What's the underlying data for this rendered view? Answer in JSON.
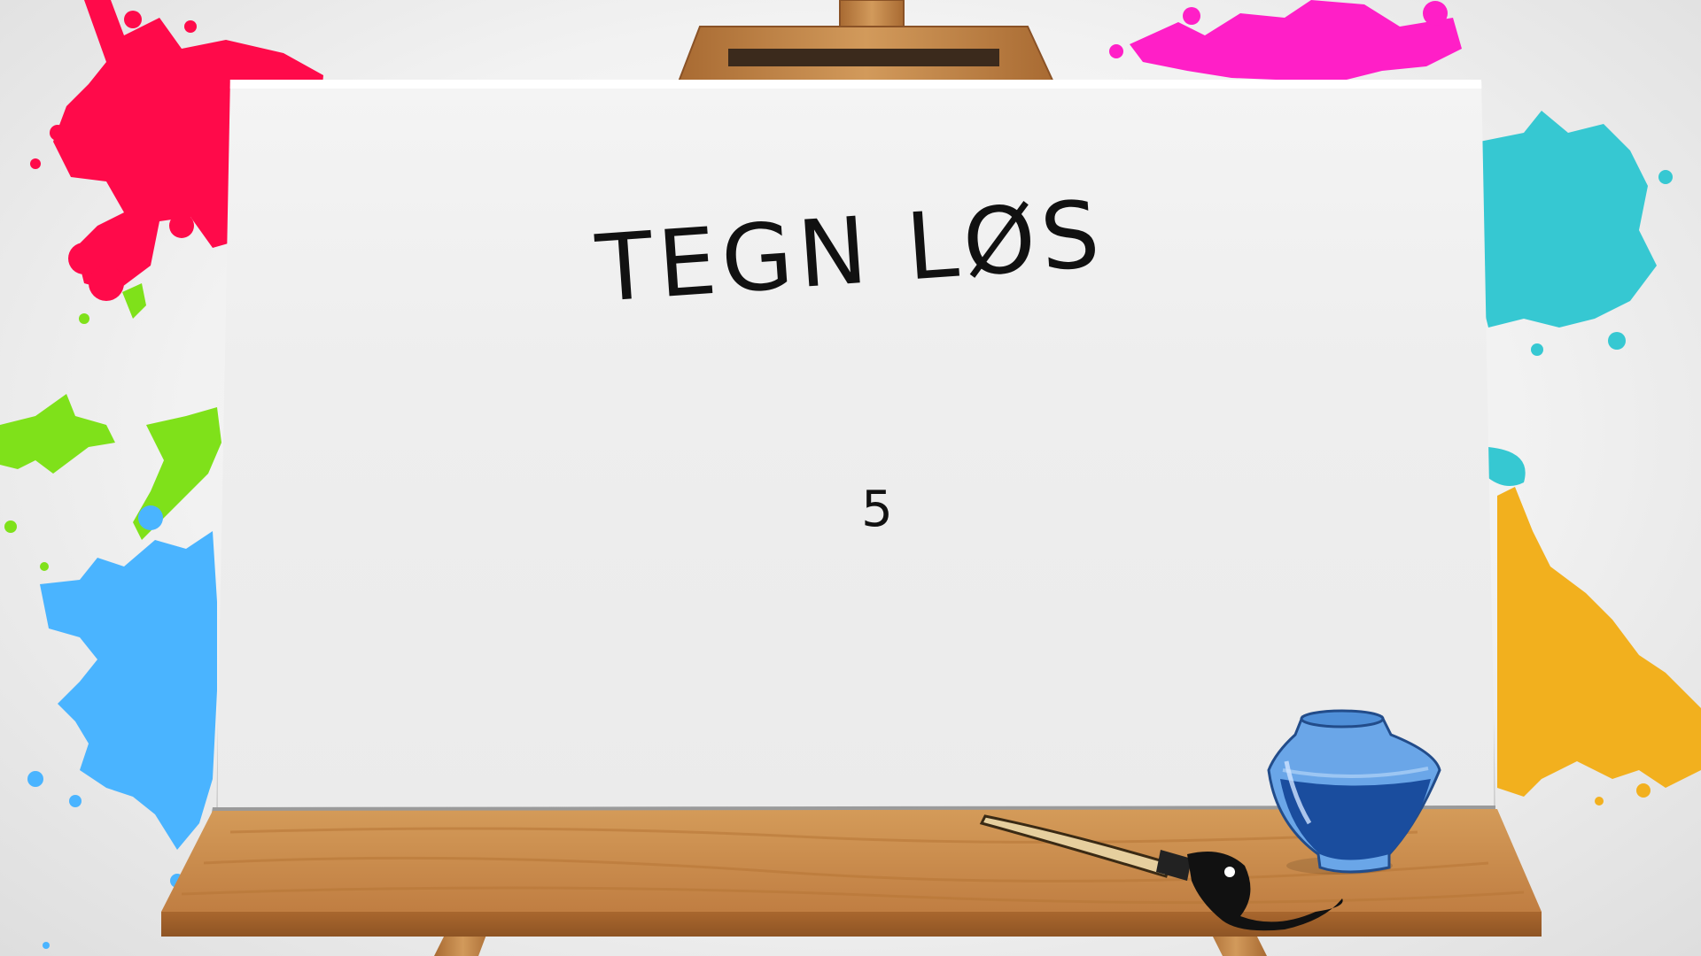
{
  "screen": {
    "title": "TEGN LØS",
    "countdown": "5"
  },
  "colors": {
    "splash_red": "#ff0a4a",
    "splash_magenta": "#ff1fc7",
    "splash_cyan": "#36c8d2",
    "splash_green": "#7fe11a",
    "splash_blue": "#4ab4ff",
    "splash_yellow": "#f2b01e",
    "wood": "#c8884a",
    "ink": "#1a4d9e"
  }
}
